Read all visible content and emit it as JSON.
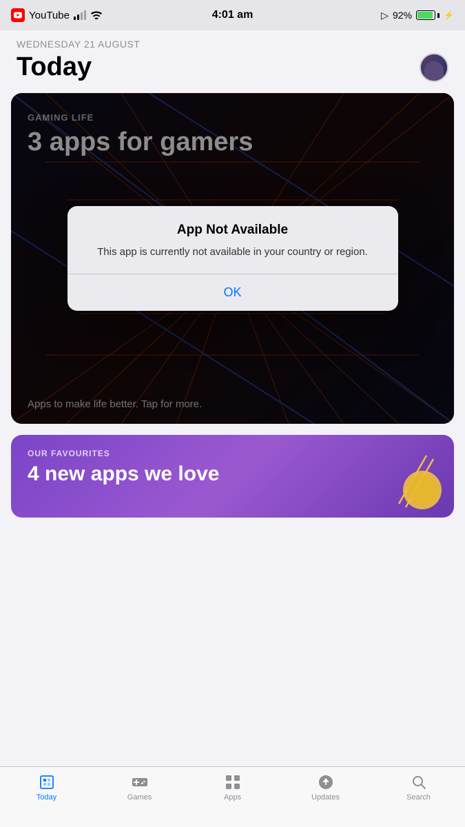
{
  "statusBar": {
    "appName": "YouTube",
    "time": "4:01 am",
    "batteryPercent": "92%",
    "signal": "medium",
    "wifi": true,
    "location": true,
    "charging": true
  },
  "todayHeader": {
    "dateLabel": "WEDNESDAY 21 AUGUST",
    "title": "Today"
  },
  "featuredCard": {
    "tag": "GAMING LIFE",
    "title": "3 apps for gamers",
    "subtitle": "Apps to make life better. Tap for more."
  },
  "dialog": {
    "title": "App Not Available",
    "message": "This app is currently not available in your country or region.",
    "okLabel": "OK"
  },
  "secondCard": {
    "tag": "OUR FAVOURITES",
    "title": "4 new apps we love"
  },
  "tabBar": {
    "items": [
      {
        "id": "today",
        "label": "Today",
        "icon": "today",
        "active": true
      },
      {
        "id": "games",
        "label": "Games",
        "icon": "games",
        "active": false
      },
      {
        "id": "apps",
        "label": "Apps",
        "icon": "apps",
        "active": false
      },
      {
        "id": "updates",
        "label": "Updates",
        "icon": "updates",
        "active": false
      },
      {
        "id": "search",
        "label": "Search",
        "icon": "search",
        "active": false
      }
    ]
  }
}
